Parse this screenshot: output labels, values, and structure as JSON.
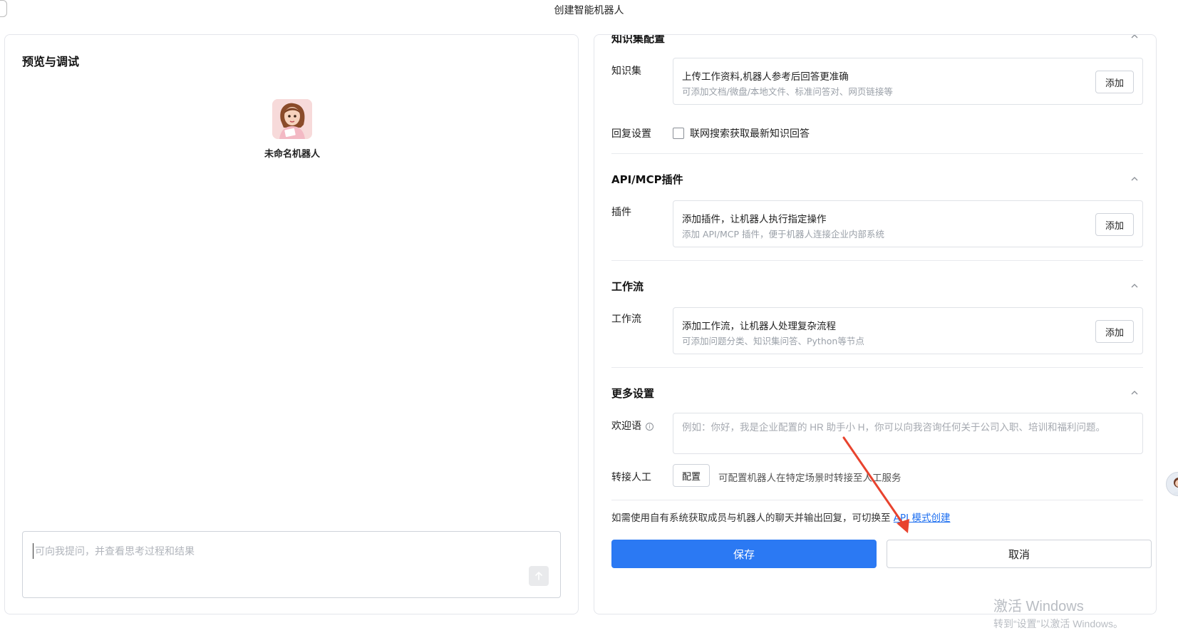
{
  "page_title": "创建智能机器人",
  "left": {
    "title": "预览与调试",
    "bot_name": "未命名机器人",
    "chat_placeholder": "可向我提问，并查看思考过程和结果"
  },
  "right": {
    "knowledge": {
      "section_title": "知识集配置",
      "label": "知识集",
      "card_main": "上传工作资料,机器人参考后回答更准确",
      "card_sub": "可添加文档/微盘/本地文件、标准问答对、网页链接等",
      "add_label": "添加"
    },
    "reply": {
      "label": "回复设置",
      "checkbox_label": "联网搜索获取最新知识回答",
      "checked": false
    },
    "plugins": {
      "section_title": "API/MCP插件",
      "label": "插件",
      "card_main": "添加插件，让机器人执行指定操作",
      "card_sub": "添加 API/MCP 插件，便于机器人连接企业内部系统",
      "add_label": "添加"
    },
    "workflow": {
      "section_title": "工作流",
      "label": "工作流",
      "card_main": "添加工作流，让机器人处理复杂流程",
      "card_sub": "可添加问题分类、知识集问答、Python等节点",
      "add_label": "添加"
    },
    "more": {
      "section_title": "更多设置",
      "welcome_label": "欢迎语",
      "welcome_placeholder": "例如：你好，我是企业配置的 HR 助手小 H，你可以向我咨询任何关于公司入职、培训和福利问题。",
      "transfer_label": "转接人工",
      "config_label": "配置",
      "transfer_desc": "可配置机器人在特定场景时转接至人工服务"
    },
    "api_hint_text": "如需使用自有系统获取成员与机器人的聊天并输出回复，可切换至",
    "api_link_text": "API 模式创建",
    "save_label": "保存",
    "cancel_label": "取消"
  },
  "watermark": {
    "line1": "激活 Windows",
    "line2": "转到“设置”以激活 Windows。"
  },
  "colors": {
    "primary": "#2b79f3",
    "link": "#1e6ff0",
    "annotation_arrow": "#e8432e"
  },
  "icons": [
    "chevron-up-icon",
    "info-icon",
    "arrow-up-icon",
    "avatar"
  ]
}
